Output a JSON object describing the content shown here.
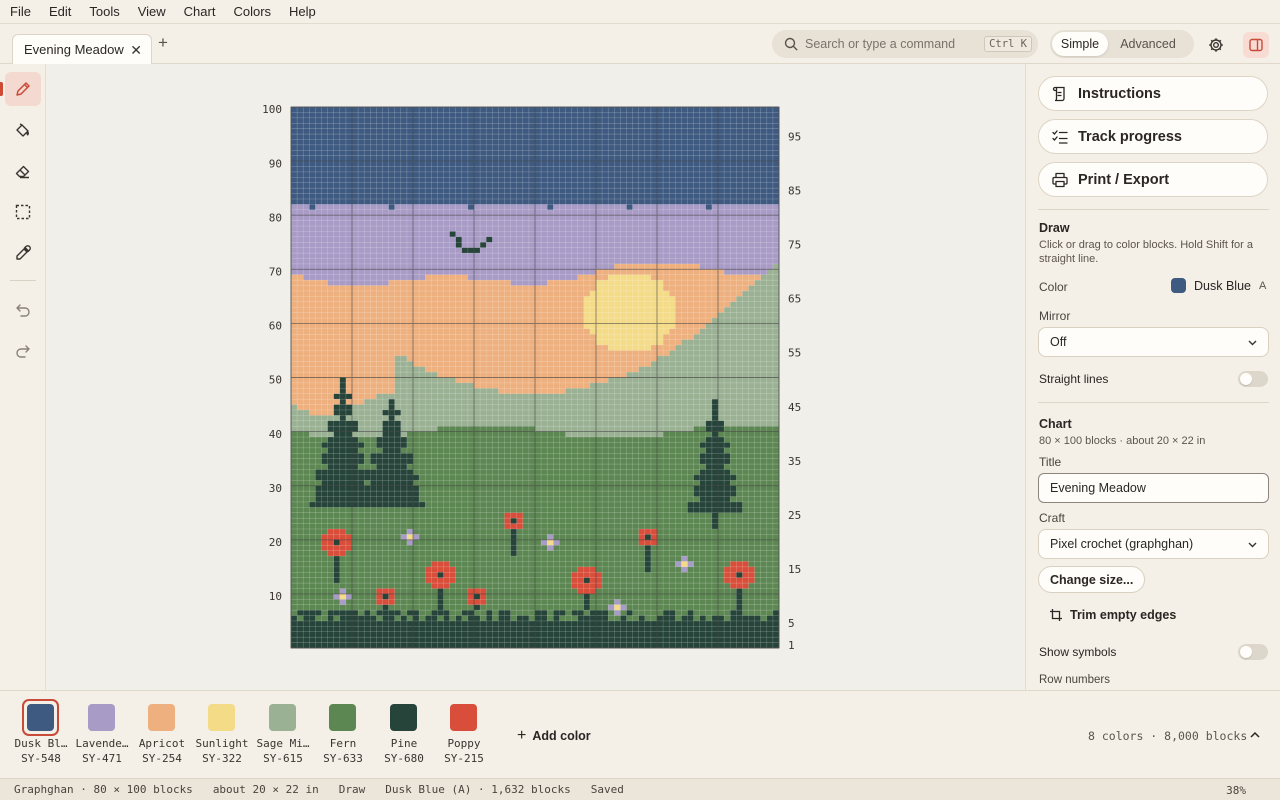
{
  "menu": [
    "File",
    "Edit",
    "Tools",
    "View",
    "Chart",
    "Colors",
    "Help"
  ],
  "tab": {
    "title": "Evening Meadow",
    "close": "✕",
    "new": "+"
  },
  "search": {
    "placeholder": "Search or type a command",
    "shortcut": "Ctrl K"
  },
  "mode": {
    "simple": "Simple",
    "advanced": "Advanced",
    "selected": "Simple"
  },
  "tools": [
    {
      "name": "pencil-tool",
      "active": true
    },
    {
      "name": "fill-tool",
      "active": false
    },
    {
      "name": "eraser-tool",
      "active": false
    },
    {
      "name": "select-tool",
      "active": false
    },
    {
      "name": "eyedropper-tool",
      "active": false
    },
    {
      "name": "undo-button",
      "active": false
    },
    {
      "name": "redo-button",
      "active": false
    }
  ],
  "panel": {
    "instructions": "Instructions",
    "track": "Track progress",
    "print": "Print / Export",
    "draw": {
      "title": "Draw",
      "desc": "Click or drag to color blocks. Hold Shift for a straight line.",
      "color_label": "Color",
      "color_name": "Dusk Blue",
      "color_symbol": "A",
      "mirror_label": "Mirror",
      "mirror_value": "Off",
      "straight_label": "Straight lines",
      "straight_on": false
    },
    "chart": {
      "title": "Chart",
      "desc": "80 × 100 blocks · about 20 × 22 in",
      "title_label": "Title",
      "title_value": "Evening Meadow",
      "craft_label": "Craft",
      "craft_value": "Pixel crochet (graphghan)",
      "change_size": "Change size...",
      "trim": "Trim empty edges",
      "symbols_label": "Show symbols",
      "symbols_on": false,
      "row_numbers_label": "Row numbers"
    }
  },
  "palette": [
    {
      "name": "Dusk Blue",
      "display": "Dusk Bl…",
      "code": "SY-548",
      "hex": "#3f5a80",
      "selected": true
    },
    {
      "name": "Lavender",
      "display": "Lavende…",
      "code": "SY-471",
      "hex": "#a89bc6",
      "selected": false
    },
    {
      "name": "Apricot",
      "display": "Apricot",
      "code": "SY-254",
      "hex": "#eeb07e",
      "selected": false
    },
    {
      "name": "Sunlight",
      "display": "Sunlight",
      "code": "SY-322",
      "hex": "#f4db88",
      "selected": false
    },
    {
      "name": "Sage Mist",
      "display": "Sage Mi…",
      "code": "SY-615",
      "hex": "#9bb194",
      "selected": false
    },
    {
      "name": "Fern",
      "display": "Fern",
      "code": "SY-633",
      "hex": "#5c8752",
      "selected": false
    },
    {
      "name": "Pine",
      "display": "Pine",
      "code": "SY-680",
      "hex": "#26443a",
      "selected": false
    },
    {
      "name": "Poppy",
      "display": "Poppy",
      "code": "SY-215",
      "hex": "#d94e3a",
      "selected": false
    }
  ],
  "add_color": "Add color",
  "palette_summary": "8 colors · 8,000 blocks",
  "grid": {
    "cols": 80,
    "rows": 100,
    "left_labels": [
      "100",
      "90",
      "80",
      "70",
      "60",
      "50",
      "40",
      "30",
      "20",
      "10"
    ],
    "right_labels": [
      "95",
      "85",
      "75",
      "65",
      "55",
      "45",
      "35",
      "25",
      "15",
      "5",
      "1"
    ],
    "colors": {
      "dusk": "#3f5a80",
      "lavender": "#a89bc6",
      "apricot": "#eeb07e",
      "sun": "#f4db88",
      "sage": "#9bb194",
      "fern": "#5c8752",
      "pine": "#26443a",
      "poppy": "#d94e3a"
    }
  },
  "status": {
    "mode": "Graphghan · 80 × 100 blocks",
    "size": "about 20 × 22 in",
    "tool": "Draw",
    "color": "Dusk Blue (A) · 1,632 blocks",
    "saved": "Saved",
    "zoom": "38%"
  }
}
